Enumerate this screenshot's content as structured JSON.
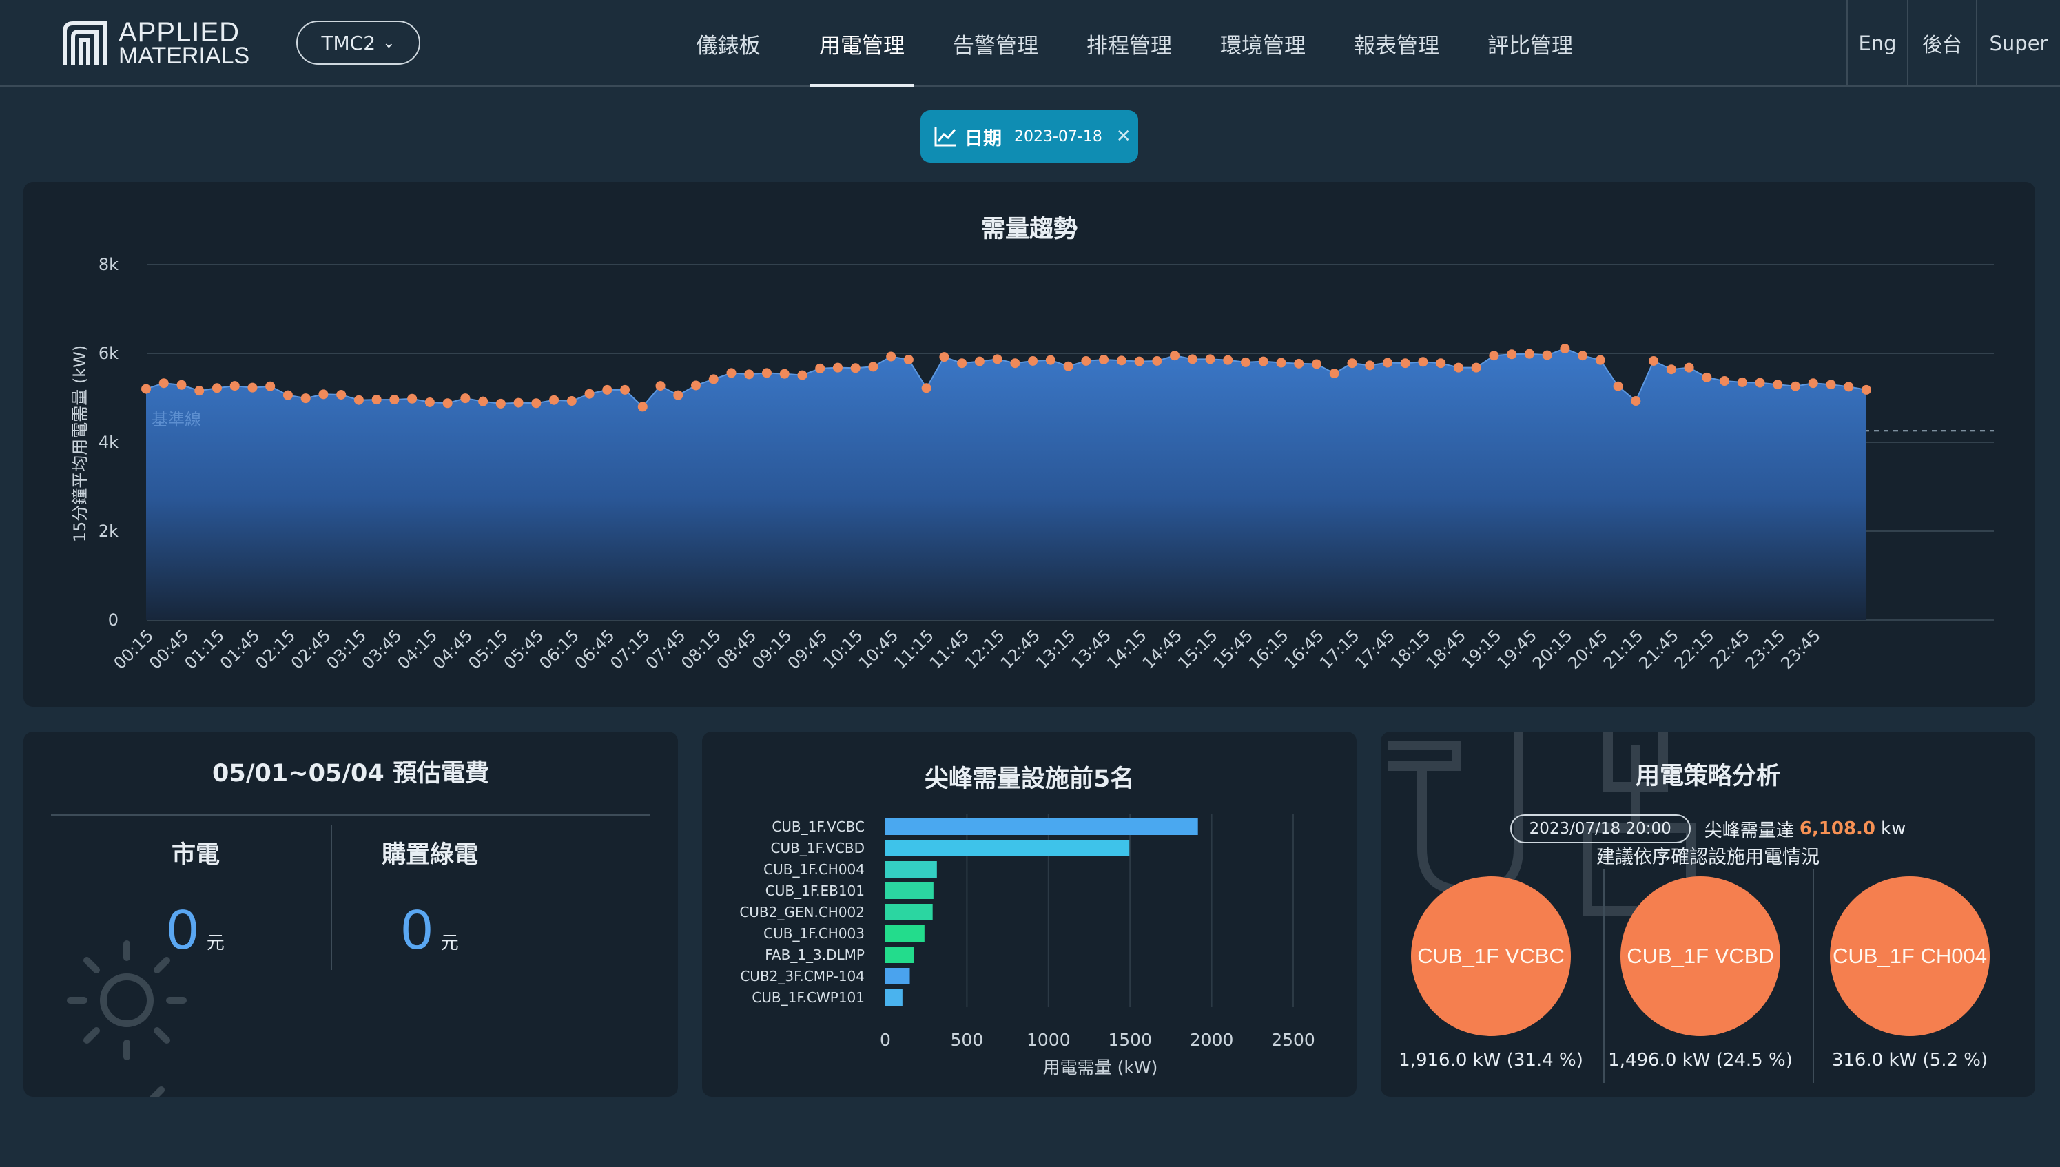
{
  "header": {
    "logo_line1": "APPLIED",
    "logo_line2": "MATERIALS",
    "site_selector": "TMC2",
    "nav": [
      "儀錶板",
      "用電管理",
      "告警管理",
      "排程管理",
      "環境管理",
      "報表管理",
      "評比管理"
    ],
    "active_nav": "用電管理",
    "right_links": [
      "Eng",
      "後台",
      "Super"
    ]
  },
  "date_filter": {
    "label": "日期",
    "value": "2023-07-18"
  },
  "trend": {
    "title": "需量趨勢",
    "baseline_label": "基準線",
    "chart_data": {
      "type": "area",
      "title": "需量趨勢",
      "ylabel": "15分鐘平均用電需量 (kW)",
      "xlabel": "",
      "ylim": [
        0,
        8000
      ],
      "yticks": [
        "0",
        "2k",
        "4k",
        "6k",
        "8k"
      ],
      "baseline": 4260,
      "x_tick_labels": [
        "00:15",
        "00:45",
        "01:15",
        "01:45",
        "02:15",
        "02:45",
        "03:15",
        "03:45",
        "04:15",
        "04:45",
        "05:15",
        "05:45",
        "06:15",
        "06:45",
        "07:15",
        "07:45",
        "08:15",
        "08:45",
        "09:15",
        "09:45",
        "10:15",
        "10:45",
        "11:15",
        "11:45",
        "12:15",
        "12:45",
        "13:15",
        "13:45",
        "14:15",
        "14:45",
        "15:15",
        "15:45",
        "16:15",
        "16:45",
        "17:15",
        "17:45",
        "18:15",
        "18:45",
        "19:15",
        "19:45",
        "20:15",
        "20:45",
        "21:15",
        "21:45",
        "22:15",
        "22:45",
        "23:15",
        "23:45"
      ],
      "x_start": "00:15",
      "x_step_minutes": 15,
      "values": [
        5200,
        5330,
        5290,
        5160,
        5220,
        5270,
        5230,
        5260,
        5060,
        4990,
        5080,
        5070,
        4950,
        4960,
        4960,
        4980,
        4900,
        4880,
        4990,
        4920,
        4870,
        4890,
        4880,
        4950,
        4930,
        5090,
        5180,
        5180,
        4800,
        5270,
        5060,
        5280,
        5420,
        5560,
        5530,
        5560,
        5540,
        5510,
        5660,
        5680,
        5670,
        5700,
        5930,
        5860,
        5220,
        5920,
        5780,
        5820,
        5870,
        5780,
        5830,
        5850,
        5710,
        5830,
        5860,
        5840,
        5820,
        5830,
        5950,
        5870,
        5870,
        5850,
        5800,
        5820,
        5790,
        5770,
        5760,
        5550,
        5780,
        5730,
        5790,
        5780,
        5810,
        5780,
        5680,
        5680,
        5950,
        5980,
        5990,
        5960,
        6108,
        5950,
        5850,
        5260,
        4930,
        5830,
        5640,
        5680,
        5460,
        5380,
        5350,
        5340,
        5300,
        5260,
        5330,
        5300,
        5250,
        5180
      ]
    }
  },
  "fee": {
    "title": "05/01~05/04 預估電費",
    "columns": [
      {
        "label": "市電",
        "value": "0",
        "unit": "元"
      },
      {
        "label": "購置綠電",
        "value": "0",
        "unit": "元"
      }
    ]
  },
  "top5": {
    "title": "尖峰需量設施前5名",
    "chart_data": {
      "type": "bar",
      "orientation": "horizontal",
      "title": "尖峰需量設施前5名",
      "xlabel": "用電需量 (kW)",
      "xlim": [
        0,
        2500
      ],
      "xticks": [
        "0",
        "500",
        "1000",
        "1500",
        "2000",
        "2500"
      ],
      "categories": [
        "CUB_1F.VCBC",
        "CUB_1F.VCBD",
        "CUB_1F.CH004",
        "CUB_1F.EB101",
        "CUB2_GEN.CH002",
        "CUB_1F.CH003",
        "FAB_1_3.DLMP",
        "CUB2_3F.CMP-104",
        "CUB_1F.CWP101"
      ],
      "values": [
        1916,
        1496,
        316,
        295,
        290,
        240,
        175,
        150,
        105
      ],
      "colors": [
        "#4aa8f0",
        "#3ec3ea",
        "#34cfc3",
        "#2bd6a1",
        "#2bd6a1",
        "#23dc8c",
        "#23dc8c",
        "#4aa3ee",
        "#4ab3ee"
      ]
    }
  },
  "strategy": {
    "title": "用電策略分析",
    "peak_time": "2023/07/18 20:00",
    "peak_text": "尖峰需量達",
    "peak_value": "6,108.0",
    "peak_unit": "kw",
    "advice": "建議依序確認設施用電情況",
    "items": [
      {
        "name": "CUB_1F VCBC",
        "value": "1,916.0 kW (31.4 %)"
      },
      {
        "name": "CUB_1F VCBD",
        "value": "1,496.0 kW (24.5 %)"
      },
      {
        "name": "CUB_1F CH004",
        "value": "316.0 kW (5.2 %)"
      }
    ]
  },
  "colors": {
    "accent": "#0f8db3",
    "orange": "#f57f4f",
    "blue_value": "#5aa7f2",
    "panel_bg": "#16222d",
    "page_bg": "#1c2d3b"
  }
}
